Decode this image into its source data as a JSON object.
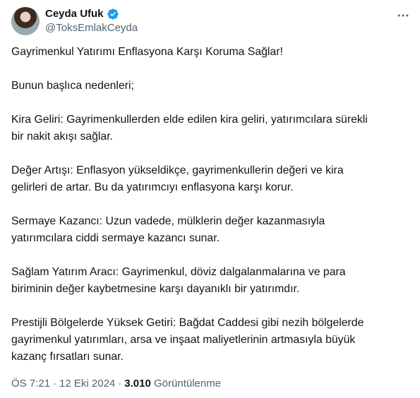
{
  "author": {
    "name": "Ceyda Ufuk",
    "handle": "@ToksEmlakCeyda",
    "verified_color": "#1d9bf0"
  },
  "icons": {
    "verified": "verified-badge-icon",
    "more": "more-horizontal-icon"
  },
  "tweet": {
    "paragraphs": [
      "Gayrimenkul Yatırımı Enflasyona Karşı Koruma Sağlar!",
      "Bunun başlıca nedenleri;",
      "Kira Geliri: Gayrimenkullerden elde edilen kira geliri, yatırımcılara sürekli\nbir nakit akışı sağlar.",
      "Değer Artışı: Enflasyon yükseldikçe, gayrimenkullerin değeri ve kira\ngelirleri de artar. Bu da yatırımcıyı enflasyona karşı korur.",
      "Sermaye Kazancı: Uzun vadede, mülklerin değer kazanmasıyla\nyatırımcılara ciddi sermaye kazancı sunar.",
      "Sağlam Yatırım Aracı: Gayrimenkul, döviz dalgalanmalarına ve para\nbiriminin değer kaybetmesine karşı dayanıklı bir yatırımdır.",
      "Prestijli Bölgelerde Yüksek Getiri: Bağdat Caddesi gibi nezih bölgelerde\ngayrimenkul yatırımları, arsa ve inşaat maliyetlerinin artmasıyla büyük\nkazanç fırsatları sunar."
    ]
  },
  "meta": {
    "time": "ÖS 7:21",
    "separator": "·",
    "date": "12 Eki 2024",
    "views_count": "3.010",
    "views_label": "Görüntülenme"
  }
}
